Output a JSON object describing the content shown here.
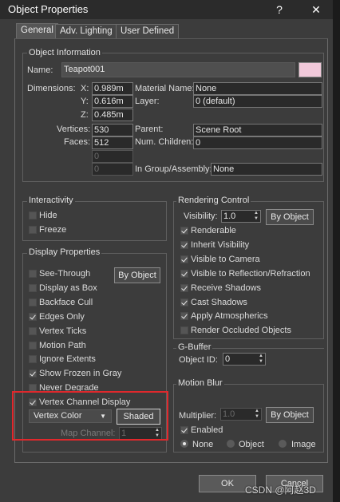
{
  "window": {
    "title": "Object Properties",
    "help_glyph": "?",
    "close_glyph": "✕"
  },
  "tabs": [
    {
      "label": "General",
      "active": true
    },
    {
      "label": "Adv. Lighting",
      "active": false
    },
    {
      "label": "User Defined",
      "active": false
    }
  ],
  "object_info": {
    "group_label": "Object Information",
    "name_label": "Name:",
    "name_value": "Teapot001",
    "color_swatch": "#f1c9da",
    "dimensions_label": "Dimensions:",
    "x_label": "X:",
    "x_value": "0.989m",
    "y_label": "Y:",
    "y_value": "0.616m",
    "z_label": "Z:",
    "z_value": "0.485m",
    "material_name_label": "Material Name:",
    "material_name_value": "None",
    "layer_label": "Layer:",
    "layer_value": "0 (default)",
    "vertices_label": "Vertices:",
    "vertices_value": "530",
    "faces_label": "Faces:",
    "faces_value": "512",
    "extra1_value": "0",
    "extra2_value": "0",
    "parent_label": "Parent:",
    "parent_value": "Scene Root",
    "num_children_label": "Num. Children:",
    "num_children_value": "0",
    "group_assembly_label": "In Group/Assembly:",
    "group_assembly_value": "None"
  },
  "interactivity": {
    "group_label": "Interactivity",
    "hide_label": "Hide",
    "hide_checked": false,
    "freeze_label": "Freeze",
    "freeze_checked": false
  },
  "display_properties": {
    "group_label": "Display Properties",
    "by_object_label": "By Object",
    "items": [
      {
        "label": "See-Through",
        "checked": false
      },
      {
        "label": "Display as Box",
        "checked": false
      },
      {
        "label": "Backface Cull",
        "checked": false
      },
      {
        "label": "Edges Only",
        "checked": true
      },
      {
        "label": "Vertex Ticks",
        "checked": false
      },
      {
        "label": "Motion Path",
        "checked": false
      },
      {
        "label": "Ignore Extents",
        "checked": false
      },
      {
        "label": "Show Frozen in Gray",
        "checked": true
      },
      {
        "label": "Never Degrade",
        "checked": false
      },
      {
        "label": "Vertex Channel Display",
        "checked": true
      }
    ],
    "vertex_color_select": "Vertex Color",
    "shaded_label": "Shaded",
    "map_channel_label": "Map Channel:",
    "map_channel_value": "1"
  },
  "rendering_control": {
    "group_label": "Rendering Control",
    "visibility_label": "Visibility:",
    "visibility_value": "1.0",
    "by_object_label": "By Object",
    "items": [
      {
        "label": "Renderable",
        "checked": true
      },
      {
        "label": "Inherit Visibility",
        "checked": true
      },
      {
        "label": "Visible to Camera",
        "checked": true
      },
      {
        "label": "Visible to Reflection/Refraction",
        "checked": true
      },
      {
        "label": "Receive Shadows",
        "checked": true
      },
      {
        "label": "Cast Shadows",
        "checked": true
      },
      {
        "label": "Apply Atmospherics",
        "checked": true
      },
      {
        "label": "Render Occluded Objects",
        "checked": false
      }
    ]
  },
  "gbuffer": {
    "group_label": "G-Buffer",
    "object_id_label": "Object ID:",
    "object_id_value": "0"
  },
  "motion_blur": {
    "group_label": "Motion Blur",
    "multiplier_label": "Multiplier:",
    "multiplier_value": "1.0",
    "by_object_label": "By Object",
    "enabled_label": "Enabled",
    "enabled_checked": true,
    "options": [
      {
        "label": "None",
        "selected": true
      },
      {
        "label": "Object",
        "selected": false
      },
      {
        "label": "Image",
        "selected": false
      }
    ]
  },
  "footer": {
    "ok_label": "OK",
    "cancel_label": "Cancel",
    "watermark": "CSDN @阿赵3D"
  }
}
